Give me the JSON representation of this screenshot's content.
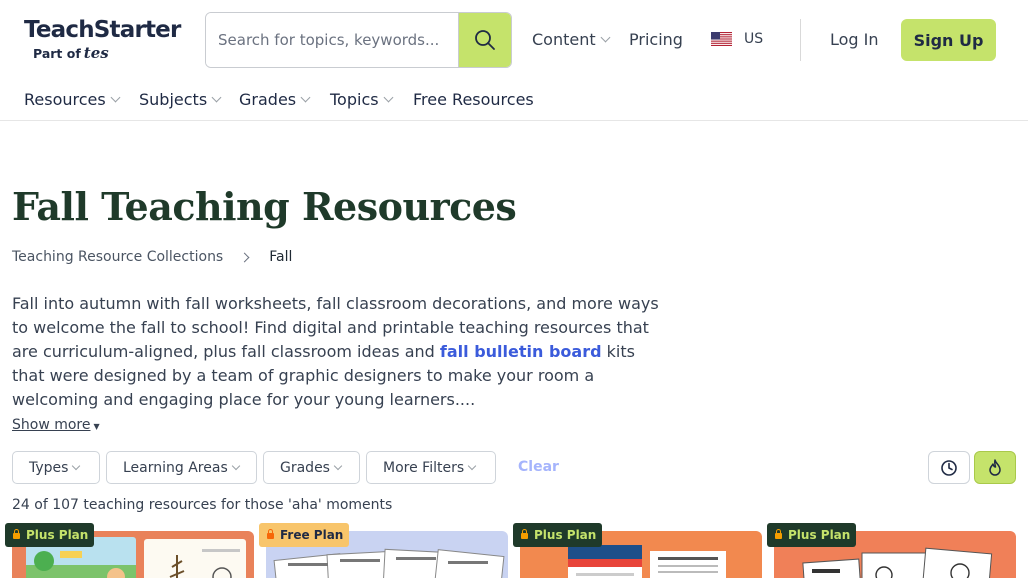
{
  "header": {
    "logo": {
      "main": "TeachStarter",
      "sub_prefix": "Part of",
      "sub_brand": "tes"
    },
    "search": {
      "placeholder": "Search for topics, keywords..."
    },
    "nav": {
      "content": "Content",
      "pricing": "Pricing",
      "region": "US"
    },
    "login": "Log In",
    "signup": "Sign Up"
  },
  "subnav": [
    {
      "label": "Resources",
      "has_dropdown": true
    },
    {
      "label": "Subjects",
      "has_dropdown": true
    },
    {
      "label": "Grades",
      "has_dropdown": true
    },
    {
      "label": "Topics",
      "has_dropdown": true
    },
    {
      "label": "Free Resources",
      "has_dropdown": false
    }
  ],
  "page": {
    "title": "Fall Teaching Resources",
    "breadcrumb": [
      "Teaching Resource Collections",
      "Fall"
    ],
    "description": {
      "before_link": "Fall into autumn with fall worksheets, fall classroom decorations, and more ways to welcome the fall to school! Find digital and printable teaching resources that are curriculum-aligned, plus fall classroom ideas and ",
      "link": "fall bulletin board",
      "after_link": " kits that were designed by a team of graphic designers to make your room a welcoming and engaging place for your young learners...."
    },
    "show_more": "Show more",
    "filters": [
      "Types",
      "Learning Areas",
      "Grades",
      "More Filters"
    ],
    "clear": "Clear",
    "sort_icons": [
      "clock-icon",
      "flame-icon"
    ],
    "result_count": "24 of 107 teaching resources for those 'aha' moments"
  },
  "cards": [
    {
      "badge": "Plus Plan",
      "tier": "plus",
      "bg": "#e9825a"
    },
    {
      "badge": "Free Plan",
      "tier": "free",
      "bg": "#c9d3f2"
    },
    {
      "badge": "Plus Plan",
      "tier": "plus",
      "bg": "#f2894f"
    },
    {
      "badge": "Plus Plan",
      "tier": "plus",
      "bg": "#f08058"
    }
  ],
  "colors": {
    "brand_green": "#c5e36b",
    "title_green": "#1f3a2a",
    "link_blue": "#3b5bdb",
    "clear_text": "#a5b4fc"
  }
}
